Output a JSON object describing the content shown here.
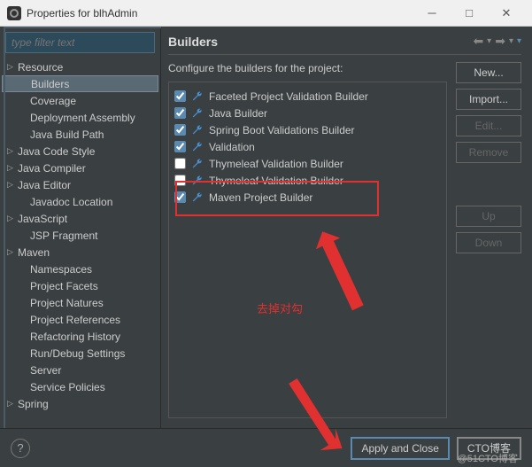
{
  "window": {
    "title": "Properties for blhAdmin"
  },
  "filter": {
    "placeholder": "type filter text"
  },
  "tree": {
    "items": [
      {
        "label": "Resource",
        "expandable": true,
        "child": false
      },
      {
        "label": "Builders",
        "expandable": false,
        "child": true,
        "selected": true
      },
      {
        "label": "Coverage",
        "expandable": false,
        "child": true
      },
      {
        "label": "Deployment Assembly",
        "expandable": false,
        "child": true
      },
      {
        "label": "Java Build Path",
        "expandable": false,
        "child": true
      },
      {
        "label": "Java Code Style",
        "expandable": true,
        "child": false
      },
      {
        "label": "Java Compiler",
        "expandable": true,
        "child": false
      },
      {
        "label": "Java Editor",
        "expandable": true,
        "child": false
      },
      {
        "label": "Javadoc Location",
        "expandable": false,
        "child": true
      },
      {
        "label": "JavaScript",
        "expandable": true,
        "child": false
      },
      {
        "label": "JSP Fragment",
        "expandable": false,
        "child": true
      },
      {
        "label": "Maven",
        "expandable": true,
        "child": false
      },
      {
        "label": "Namespaces",
        "expandable": false,
        "child": true
      },
      {
        "label": "Project Facets",
        "expandable": false,
        "child": true
      },
      {
        "label": "Project Natures",
        "expandable": false,
        "child": true
      },
      {
        "label": "Project References",
        "expandable": false,
        "child": true
      },
      {
        "label": "Refactoring History",
        "expandable": false,
        "child": true
      },
      {
        "label": "Run/Debug Settings",
        "expandable": false,
        "child": true
      },
      {
        "label": "Server",
        "expandable": false,
        "child": true
      },
      {
        "label": "Service Policies",
        "expandable": false,
        "child": true
      },
      {
        "label": "Spring",
        "expandable": true,
        "child": false
      }
    ]
  },
  "main": {
    "heading": "Builders",
    "configLabel": "Configure the builders for the project:",
    "builders": [
      {
        "label": "Faceted Project Validation Builder",
        "checked": true
      },
      {
        "label": "Java Builder",
        "checked": true
      },
      {
        "label": "Spring Boot Validations Builder",
        "checked": true
      },
      {
        "label": "Validation",
        "checked": true
      },
      {
        "label": "Thymeleaf Validation Builder",
        "checked": false
      },
      {
        "label": "Thymeleaf Validation Builder",
        "checked": false
      },
      {
        "label": "Maven Project Builder",
        "checked": true
      }
    ],
    "buttons": {
      "new": "New...",
      "import": "Import...",
      "edit": "Edit...",
      "remove": "Remove",
      "up": "Up",
      "down": "Down"
    }
  },
  "annotation": {
    "text": "去掉对勾"
  },
  "footer": {
    "apply": "Apply and Close",
    "cto": "CTO博客"
  },
  "watermark": "@51CTO博客"
}
